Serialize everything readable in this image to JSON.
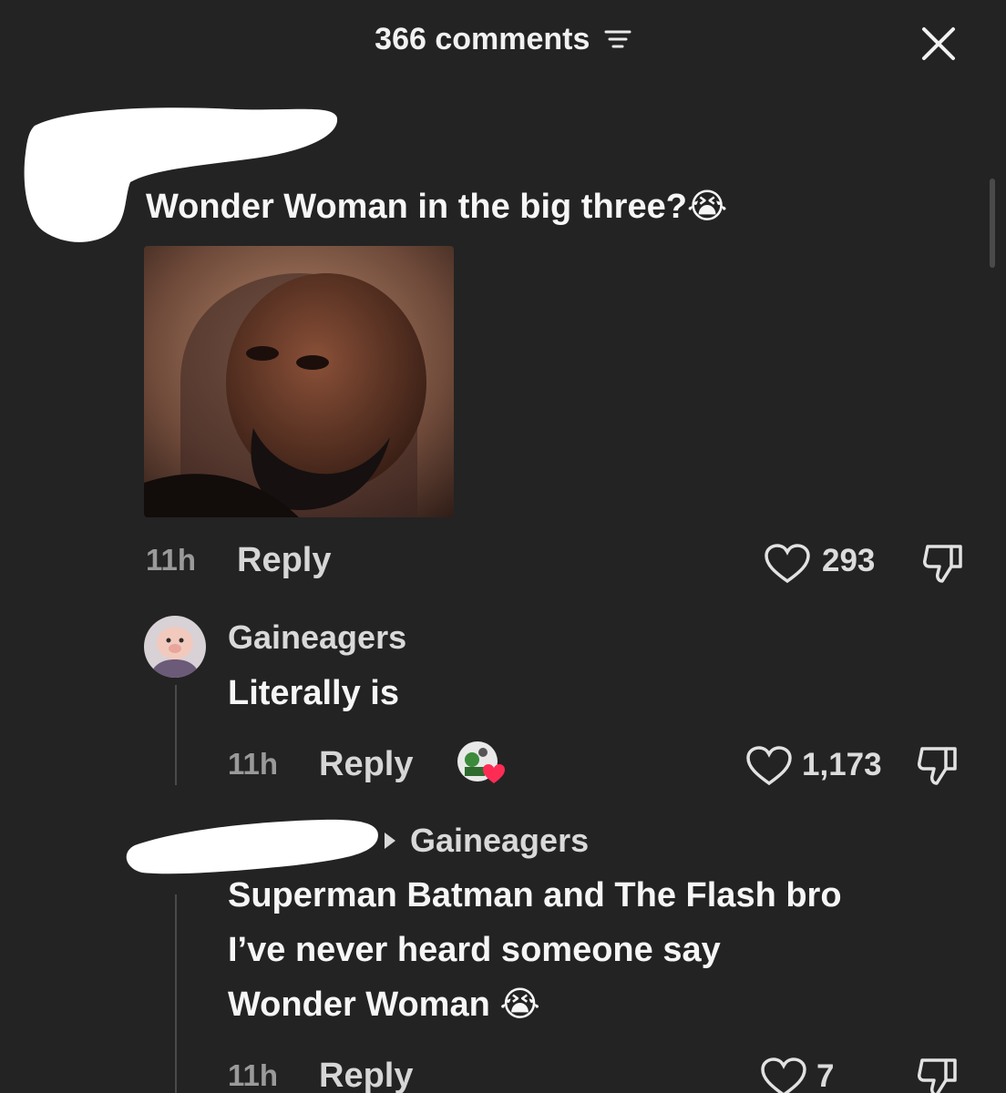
{
  "header": {
    "title": "366 comments",
    "filter_icon": "filter-sort-icon",
    "close_icon": "close-icon"
  },
  "comments": [
    {
      "text": "Wonder Woman in the big three?😭",
      "time": "11h",
      "reply_label": "Reply",
      "likes": "293",
      "has_image": true
    },
    {
      "username": "Gaineagers",
      "text": "Literally is",
      "time": "11h",
      "reply_label": "Reply",
      "likes": "1,173",
      "creator_liked": true
    },
    {
      "reply_to": "Gaineagers",
      "text_lines": [
        "Superman Batman and The Flash bro",
        "I’ve never heard someone say",
        "Wonder Woman 😭"
      ],
      "time": "11h",
      "reply_label": "Reply",
      "likes": "7"
    }
  ],
  "colors": {
    "background": "#232323",
    "text": "#ffffff",
    "muted": "#9a9a9a",
    "heart_red": "#fe2c55"
  }
}
